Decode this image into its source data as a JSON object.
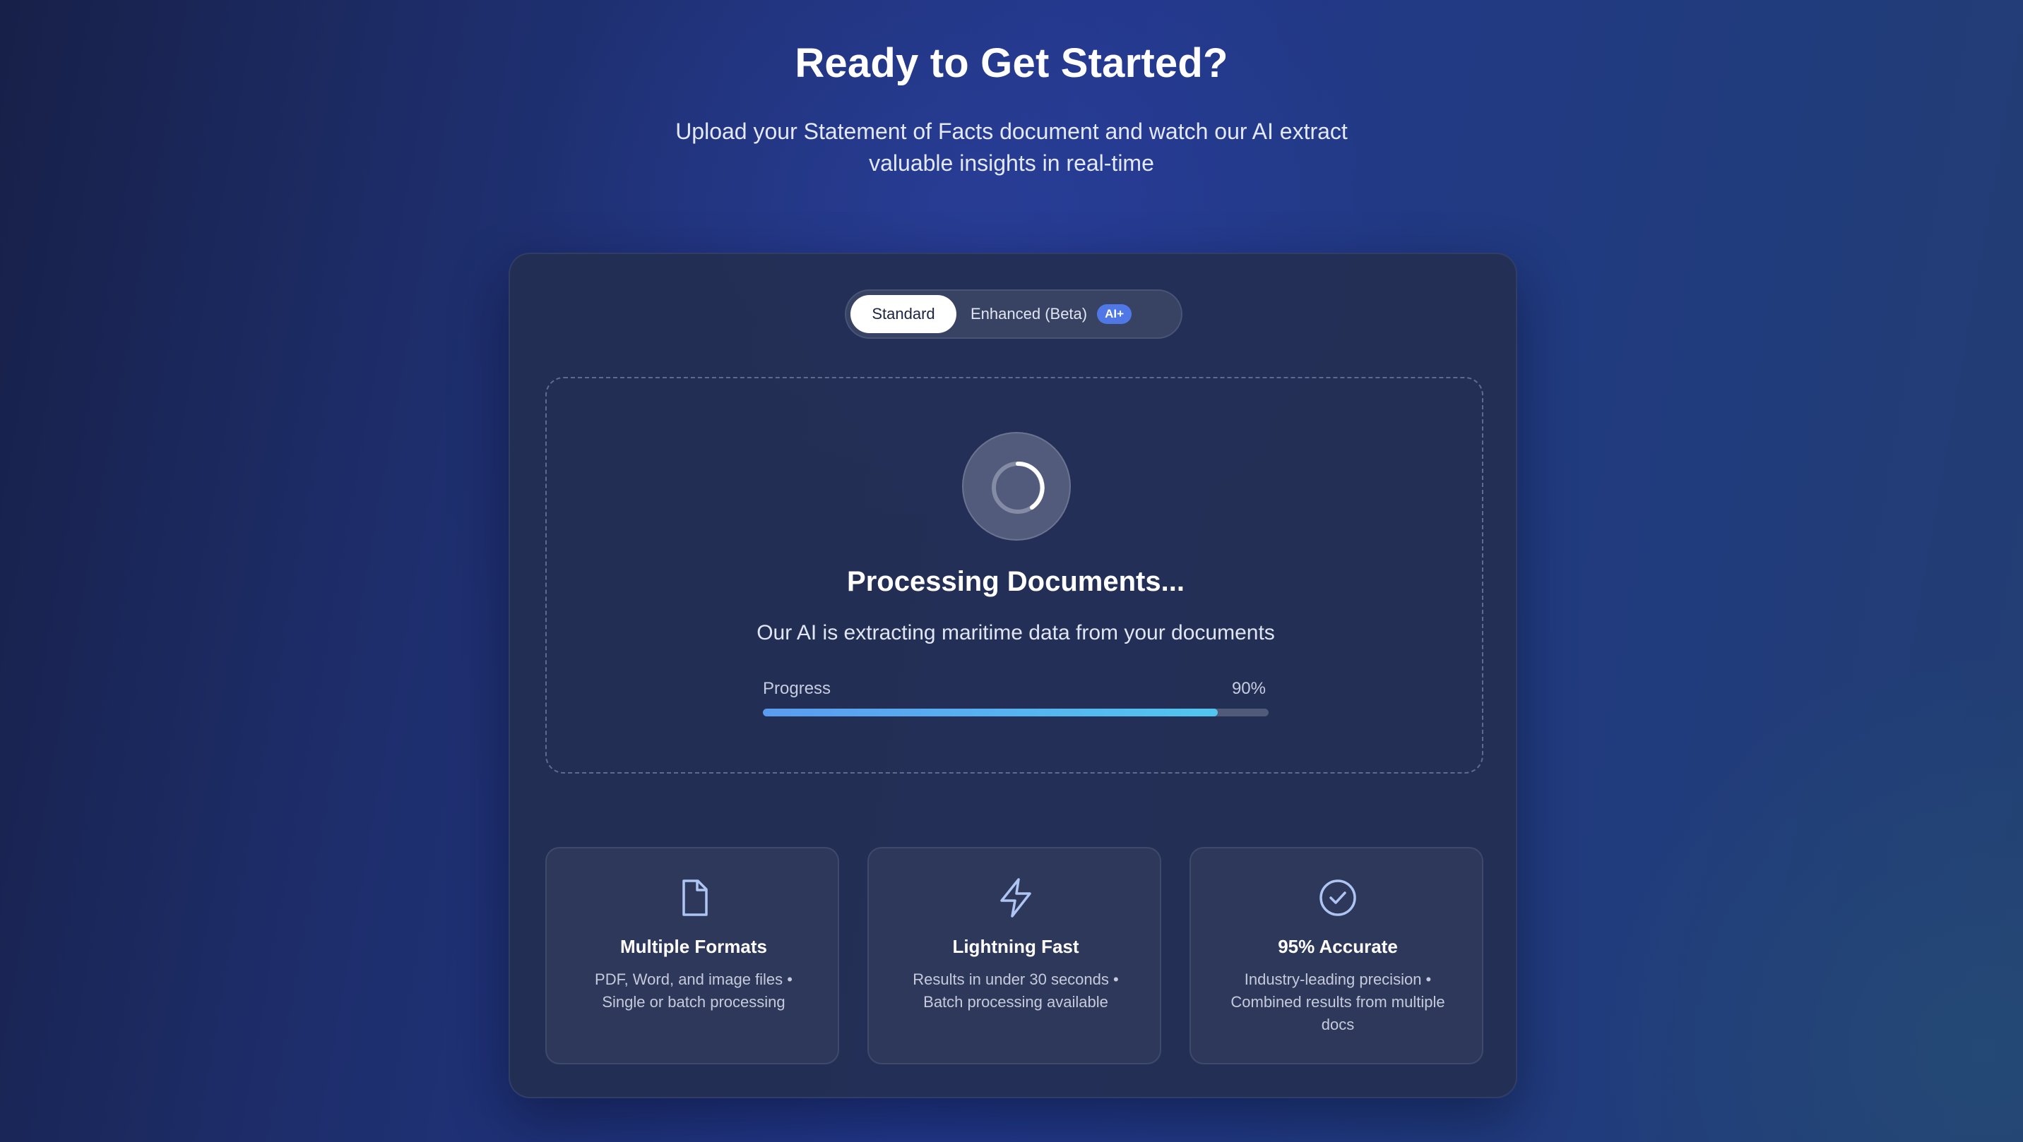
{
  "hero": {
    "title": "Ready to Get Started?",
    "subtitle": "Upload your Statement of Facts document and watch our AI extract valuable insights in real-time"
  },
  "mode_toggle": {
    "standard_label": "Standard",
    "enhanced_label": "Enhanced (Beta)",
    "enhanced_badge": "AI+",
    "selected": "Standard"
  },
  "processing": {
    "icon": "spinner-icon",
    "title": "Processing Documents...",
    "description": "Our AI is extracting maritime data from your documents",
    "progress_label": "Progress",
    "progress_percent_text": "90%",
    "progress_value": 0.9
  },
  "features": [
    {
      "icon": "document-icon",
      "title": "Multiple Formats",
      "description": "PDF, Word, and image files • Single or batch processing"
    },
    {
      "icon": "lightning-icon",
      "title": "Lightning Fast",
      "description": "Results in under 30 seconds • Batch processing available"
    },
    {
      "icon": "check-circle-icon",
      "title": "95% Accurate",
      "description": "Industry-leading precision • Combined results from multiple docs"
    }
  ],
  "colors": {
    "accent": "#4f78e6",
    "progress_start": "#5b9cf0",
    "progress_end": "#52c6ef",
    "icon_stroke": "#aec4f3"
  }
}
